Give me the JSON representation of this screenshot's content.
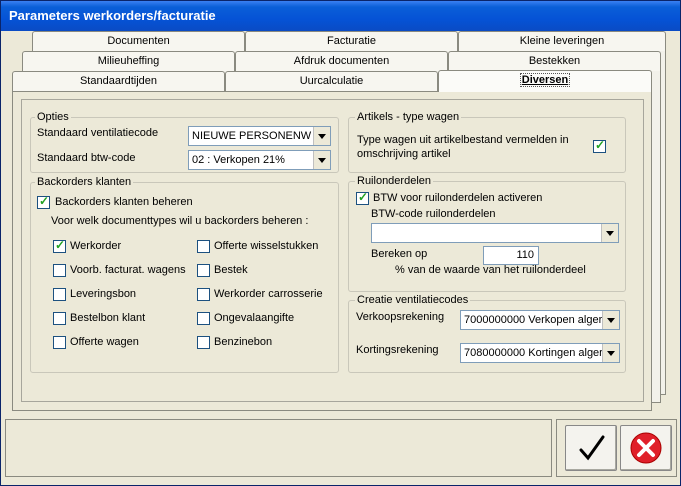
{
  "window": {
    "title": "Parameters werkorders/facturatie"
  },
  "tabs": {
    "row1": [
      "Documenten",
      "Facturatie",
      "Kleine leveringen"
    ],
    "row2": [
      "Milieuheffing",
      "Afdruk documenten",
      "Bestekken"
    ],
    "row3": [
      "Standaardtijden",
      "Uurcalculatie",
      "Diversen"
    ]
  },
  "opties": {
    "title": "Opties",
    "ventilatie_label": "Standaard ventilatiecode",
    "ventilatie_value": "NIEUWE PERSONENW",
    "btw_label": "Standaard btw-code",
    "btw_value": "02 :  Verkopen 21%"
  },
  "backorders": {
    "title": "Backorders klanten",
    "beheren_label": "Backorders klanten beheren",
    "beheren_checked": true,
    "question": "Voor welk documenttypes wil u backorders beheren :",
    "items_left": [
      {
        "label": "Werkorder",
        "checked": true
      },
      {
        "label": "Voorb. facturat. wagens",
        "checked": false
      },
      {
        "label": "Leveringsbon",
        "checked": false
      },
      {
        "label": "Bestelbon klant",
        "checked": false
      },
      {
        "label": "Offerte wagen",
        "checked": false
      }
    ],
    "items_right": [
      {
        "label": "Offerte wisselstukken",
        "checked": false
      },
      {
        "label": "Bestek",
        "checked": false
      },
      {
        "label": "Werkorder carrosserie",
        "checked": false
      },
      {
        "label": "Ongevalaangifte",
        "checked": false
      },
      {
        "label": "Benzinebon",
        "checked": false
      }
    ]
  },
  "artikels": {
    "title": "Artikels - type wagen",
    "line1": "Type wagen uit artikelbestand vermelden in",
    "line2": "omschrijving artikel",
    "checked": true
  },
  "ruilonderdelen": {
    "title": "Ruilonderdelen",
    "activeren_label": "BTW voor ruilonderdelen activeren",
    "activeren_checked": true,
    "btwcode_label": "BTW-code ruilonderdelen",
    "btwcode_value": "",
    "bereken_label": "Bereken op",
    "bereken_value": "110",
    "percent_label": "% van de waarde van het ruilonderdeel"
  },
  "ventilatiecodes": {
    "title": "Creatie ventilatiecodes",
    "verkoop_label": "Verkoopsrekening",
    "verkoop_value": "7000000000 Verkopen alger",
    "korting_label": "Kortingsrekening",
    "korting_value": "7080000000 Kortingen alger"
  },
  "buttons": {
    "ok_icon": "checkmark-icon",
    "cancel_icon": "cancel-icon"
  }
}
